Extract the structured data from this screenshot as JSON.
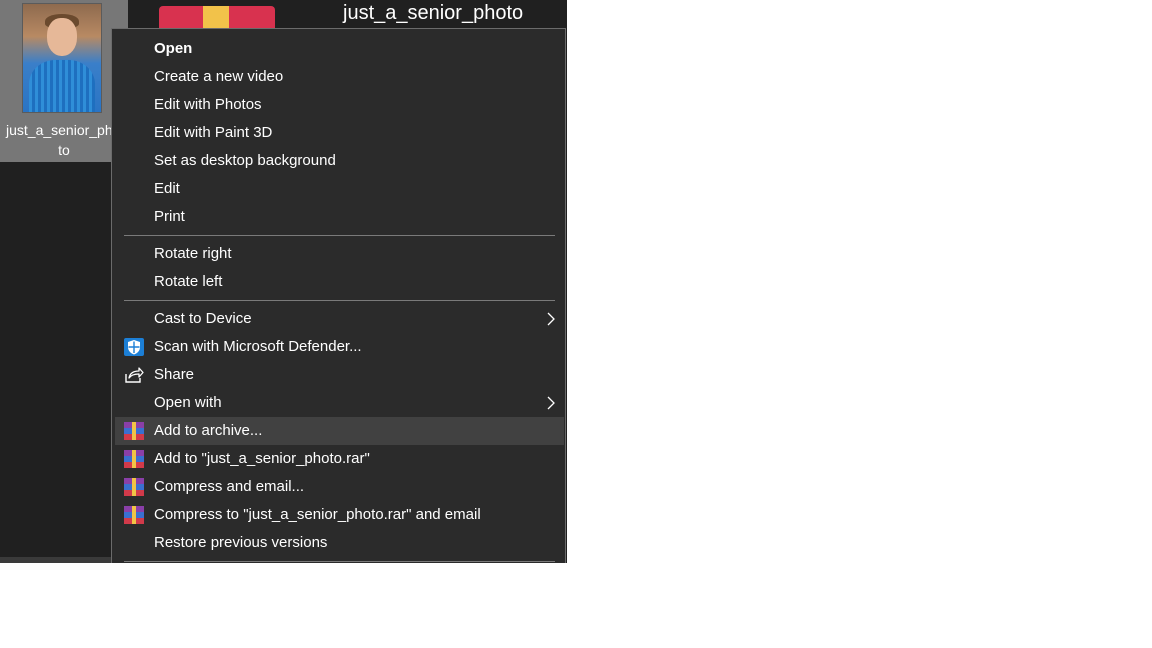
{
  "desktop": {
    "file1_name_line1": "just_a_senior_ph",
    "file1_name_line2": "to",
    "file2_name": "just_a_senior_photo"
  },
  "context_menu": {
    "items": [
      {
        "label": "Open",
        "bold": true
      },
      {
        "label": "Create a new video"
      },
      {
        "label": "Edit with Photos"
      },
      {
        "label": "Edit with Paint 3D"
      },
      {
        "label": "Set as desktop background"
      },
      {
        "label": "Edit"
      },
      {
        "label": "Print"
      },
      {
        "label": "Rotate right"
      },
      {
        "label": "Rotate left"
      },
      {
        "label": "Cast to Device",
        "submenu": true
      },
      {
        "label": "Scan with Microsoft Defender...",
        "icon": "defender-shield-icon"
      },
      {
        "label": "Share",
        "icon": "share-icon"
      },
      {
        "label": "Open with",
        "submenu": true
      },
      {
        "label": "Add to archive...",
        "icon": "winrar-icon",
        "highlighted": true
      },
      {
        "label": "Add to \"just_a_senior_photo.rar\"",
        "icon": "winrar-icon"
      },
      {
        "label": "Compress and email...",
        "icon": "winrar-icon"
      },
      {
        "label": "Compress to \"just_a_senior_photo.rar\" and email",
        "icon": "winrar-icon"
      },
      {
        "label": "Restore previous versions"
      }
    ]
  },
  "colors": {
    "menu_background": "#2b2b2b",
    "menu_highlight": "#414141",
    "separator": "#7a7a7a",
    "defender_blue": "#1c7fd6"
  }
}
